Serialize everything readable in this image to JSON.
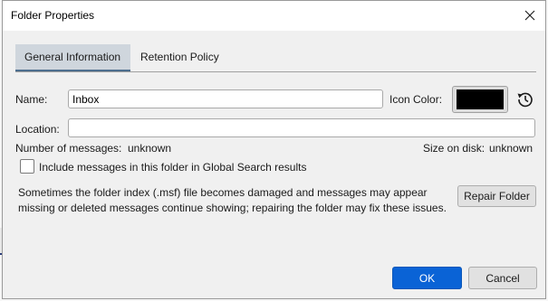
{
  "dialog": {
    "title": "Folder Properties",
    "close_icon": "close-icon"
  },
  "tabs": [
    {
      "label": "General Information",
      "active": true
    },
    {
      "label": "Retention Policy",
      "active": false
    }
  ],
  "name_field": {
    "label": "Name:",
    "value": "Inbox"
  },
  "icon_color": {
    "label": "Icon Color:",
    "color": "#000000",
    "reset_icon": "reset-history-icon"
  },
  "location_field": {
    "label": "Location:",
    "value": ""
  },
  "stats": {
    "messages_label": "Number of messages:",
    "messages_value": "unknown",
    "size_label": "Size on disk:",
    "size_value": "unknown"
  },
  "global_search": {
    "label": "Include messages in this folder in Global Search results",
    "checked": false
  },
  "repair": {
    "description": "Sometimes the folder index (.msf) file becomes damaged and messages may appear missing or deleted messages continue showing; repairing the folder may fix these issues.",
    "button_label": "Repair Folder"
  },
  "actions": {
    "ok_label": "OK",
    "cancel_label": "Cancel"
  },
  "colors": {
    "accent": "#0a63d6",
    "active_tab_bg": "#cfd6dd"
  }
}
